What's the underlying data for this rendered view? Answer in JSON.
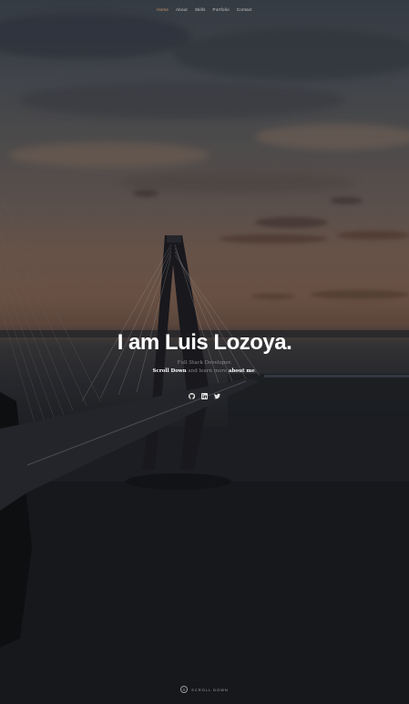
{
  "nav": {
    "items": [
      "Home",
      "About",
      "Skills",
      "Portfolio",
      "Contact"
    ],
    "active_index": 0,
    "active_color": "#d39a6a"
  },
  "intro": {
    "title": "I am Luis Lozoya.",
    "subtitle": "Full Stack Developer.",
    "tagline_start": "Scroll Down",
    "tagline_middle": " and learn more ",
    "tagline_link": "about me",
    "tagline_end": "."
  },
  "social": {
    "icons": [
      "github-icon",
      "linkedin-icon",
      "twitter-icon"
    ]
  },
  "scroll": {
    "label": "SCROLL DOWN",
    "icon": "arrow-down-icon"
  }
}
